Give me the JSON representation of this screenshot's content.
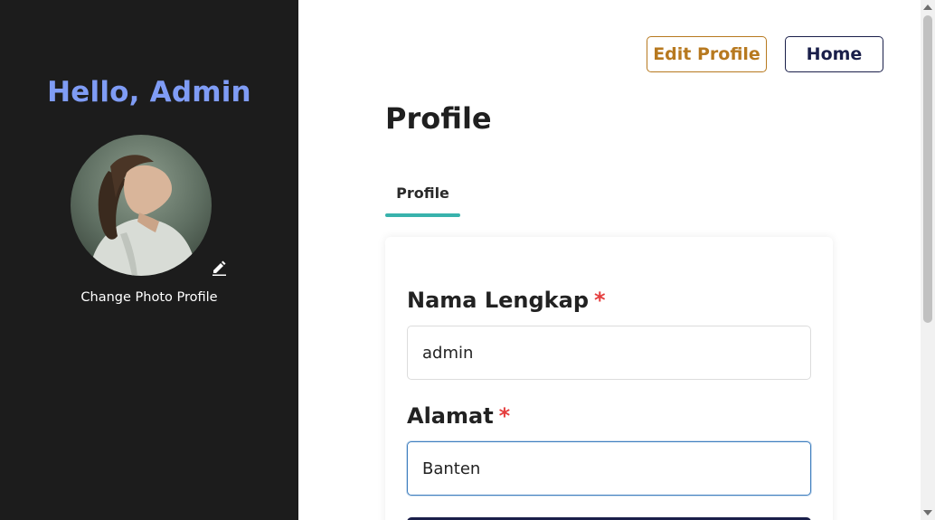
{
  "sidebar": {
    "greeting": "Hello, Admin",
    "change_photo_label": "Change Photo Profile"
  },
  "header": {
    "edit_profile_label": "Edit Profile",
    "home_label": "Home"
  },
  "page": {
    "title": "Profile",
    "tabs": [
      {
        "label": "Profile",
        "active": true
      }
    ]
  },
  "form": {
    "fields": [
      {
        "label": "Nama Lengkap",
        "required_mark": "*",
        "value": "admin"
      },
      {
        "label": "Alamat",
        "required_mark": "*",
        "value": "Banten"
      }
    ]
  },
  "colors": {
    "sidebar_bg": "#1c1c1c",
    "greeting": "#7f9cf5",
    "edit_button": "#b7791f",
    "home_button": "#1a1f4a",
    "tab_accent": "#38b2ac",
    "required": "#e53e3e",
    "focus_border": "#3f7fbf"
  },
  "icons": {
    "edit_photo": "pencil-icon"
  }
}
